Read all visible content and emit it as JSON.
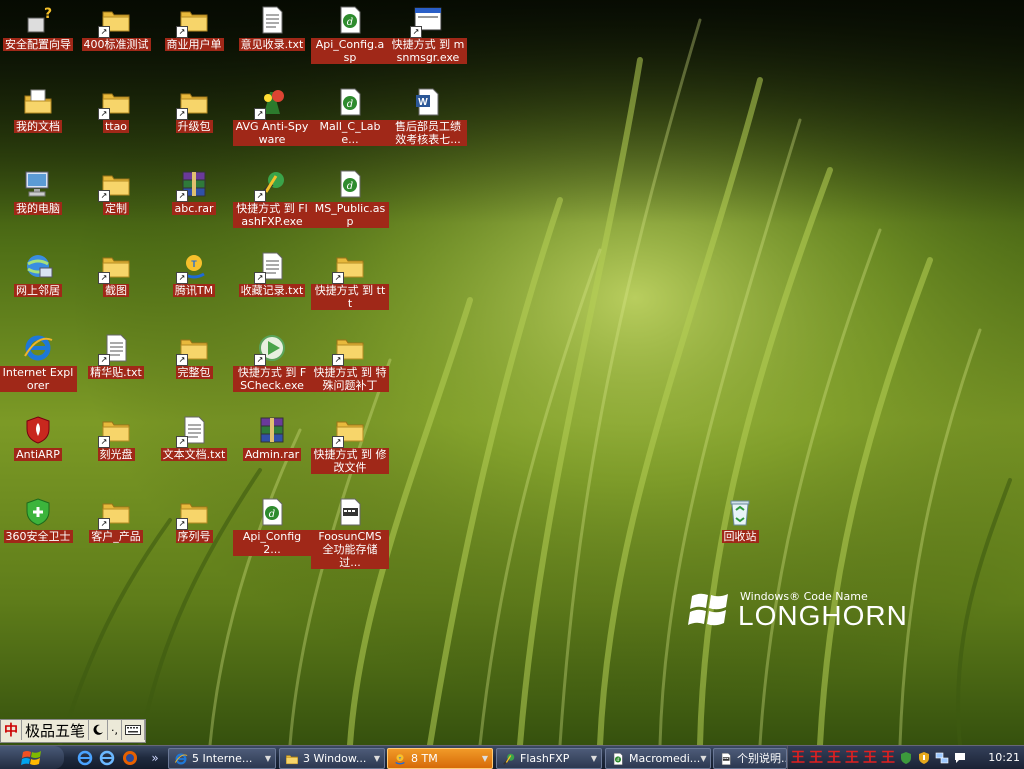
{
  "desktop": {
    "icons": [
      {
        "id": "security-wizard",
        "label": "安全配置向导",
        "icon": "wizard-icon"
      },
      {
        "id": "folder-400",
        "label": "400标准测试",
        "icon": "folder-icon"
      },
      {
        "id": "folder-biz",
        "label": "商业用户单",
        "icon": "folder-icon"
      },
      {
        "id": "txt-feedback",
        "label": "意见收录.txt",
        "icon": "text-file-icon"
      },
      {
        "id": "asp-api-config",
        "label": "Api_Config.asp",
        "icon": "dreamweaver-file-icon"
      },
      {
        "id": "lnk-msnmsgr",
        "label": "快捷方式 到 msnmsgr.exe",
        "icon": "app-window-icon"
      },
      {
        "id": "my-documents",
        "label": "我的文档",
        "icon": "my-documents-icon"
      },
      {
        "id": "folder-ttao",
        "label": "ttao",
        "icon": "folder-icon"
      },
      {
        "id": "folder-upgrade",
        "label": "升级包",
        "icon": "folder-icon"
      },
      {
        "id": "avg",
        "label": "AVG Anti-Spyware",
        "icon": "avg-icon"
      },
      {
        "id": "mall-label",
        "label": "Mall_C_Labe...",
        "icon": "dreamweaver-file-icon"
      },
      {
        "id": "doc-aftersales",
        "label": "售后部员工绩效考核表七...",
        "icon": "word-doc-icon"
      },
      {
        "id": "my-computer",
        "label": "我的电脑",
        "icon": "my-computer-icon"
      },
      {
        "id": "folder-custom",
        "label": "定制",
        "icon": "folder-icon"
      },
      {
        "id": "rar-abc",
        "label": "abc.rar",
        "icon": "rar-icon"
      },
      {
        "id": "lnk-flashfxp",
        "label": "快捷方式 到 FlashFXP.exe",
        "icon": "flashfxp-icon"
      },
      {
        "id": "asp-ms-public",
        "label": "MS_Public.asp",
        "icon": "dreamweaver-file-icon"
      },
      {
        "id": "network",
        "label": "网上邻居",
        "icon": "network-icon"
      },
      {
        "id": "folder-screenshot",
        "label": "截图",
        "icon": "folder-icon"
      },
      {
        "id": "tencent-tm",
        "label": "腾讯TM",
        "icon": "tencent-tm-icon"
      },
      {
        "id": "txt-favorites",
        "label": "收藏记录.txt",
        "icon": "text-file-icon"
      },
      {
        "id": "lnk-ttt",
        "label": "快捷方式 到 ttt",
        "icon": "folder-icon"
      },
      {
        "id": "ie",
        "label": "Internet Explorer",
        "icon": "internet-explorer-icon"
      },
      {
        "id": "txt-essence",
        "label": "精华贴.txt",
        "icon": "text-file-icon"
      },
      {
        "id": "folder-complete",
        "label": "完整包",
        "icon": "folder-icon"
      },
      {
        "id": "lnk-fscheck",
        "label": "快捷方式 到 FSCheck.exe",
        "icon": "play-icon"
      },
      {
        "id": "lnk-special-patch",
        "label": "快捷方式 到 特殊问题补丁",
        "icon": "folder-icon"
      },
      {
        "id": "antiarp",
        "label": "AntiARP",
        "icon": "antiarp-shield-icon"
      },
      {
        "id": "folder-burn",
        "label": "刻光盘",
        "icon": "folder-icon"
      },
      {
        "id": "txt-textdoc",
        "label": "文本文档.txt",
        "icon": "text-file-icon"
      },
      {
        "id": "rar-admin",
        "label": "Admin.rar",
        "icon": "rar-icon"
      },
      {
        "id": "lnk-modify-files",
        "label": "快捷方式 到 修改文件",
        "icon": "folder-icon"
      },
      {
        "id": "360-safe",
        "label": "360安全卫士",
        "icon": "360-shield-icon"
      },
      {
        "id": "folder-customer",
        "label": "客户_产品",
        "icon": "folder-icon"
      },
      {
        "id": "folder-serial",
        "label": "序列号",
        "icon": "folder-icon"
      },
      {
        "id": "api-config2",
        "label": "Api_Config2...",
        "icon": "dreamweaver-file-icon"
      },
      {
        "id": "foosun-cms",
        "label": "FoosunCMS全功能存储过...",
        "icon": "document-window-icon"
      },
      {
        "id": "recycle-bin",
        "label": "回收站",
        "icon": "recycle-bin-icon"
      }
    ]
  },
  "wallpaper": {
    "logo_small": "Windows® Code Name",
    "logo_big": "LONGHORN"
  },
  "ime": {
    "logo": "中",
    "name": "极品五笔",
    "half_width_icon": "moon-icon",
    "punct": "·,",
    "keyboard_icon": "keyboard-icon"
  },
  "taskbar": {
    "start_icon": "windows-flag-icon",
    "quick_launch": [
      "ie-quick-icon",
      "ie-quick-icon",
      "firefox-icon"
    ],
    "overflow": "»",
    "tasks": [
      {
        "label": "5 Interne...",
        "icon": "internet-explorer-icon",
        "active": false
      },
      {
        "label": "3 Window...",
        "icon": "folder-icon",
        "active": false
      },
      {
        "label": "8 TM",
        "icon": "tencent-tm-icon",
        "active": true
      },
      {
        "label": "FlashFXP",
        "icon": "flashfxp-icon",
        "active": false
      },
      {
        "label": "Macromedi...",
        "icon": "dreamweaver-file-icon",
        "active": false
      },
      {
        "label": "个别说明...",
        "icon": "document-window-icon",
        "active": false
      }
    ],
    "tray_glyphs": [
      "王",
      "王",
      "王",
      "王",
      "王",
      "王"
    ],
    "clock": "10:21"
  }
}
